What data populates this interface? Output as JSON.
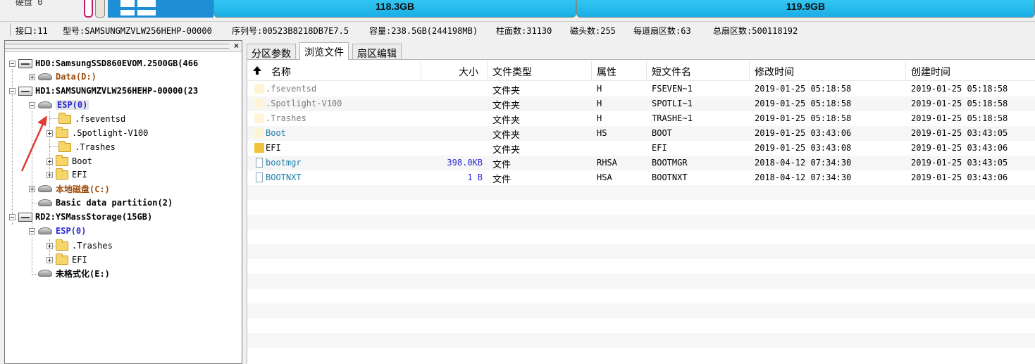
{
  "diskbar": {
    "disk_label": "硬盘 0",
    "partitions": [
      {
        "size": "118.3GB"
      },
      {
        "size": "119.9GB"
      }
    ]
  },
  "infoline": {
    "port": "接口:11",
    "model": "型号:SAMSUNGMZVLW256HEHP-00000",
    "serial": "序列号:00523B8218DB7E7.5",
    "capacity": "容量:238.5GB(244198MB)",
    "cylinders": "柱面数:31130",
    "heads": "磁头数:255",
    "sectors_per_track": "每道扇区数:63",
    "total_sectors": "总扇区数:500118192"
  },
  "tree": {
    "close": "×",
    "nodes": [
      {
        "label": "HD0:SamsungSSD860EVOM.2500GB(466"
      },
      {
        "label": "Data(D:)"
      },
      {
        "label": "HD1:SAMSUNGMZVLW256HEHP-00000(23"
      },
      {
        "label": "ESP(0)"
      },
      {
        "label": ".fseventsd"
      },
      {
        "label": ".Spotlight-V100"
      },
      {
        "label": ".Trashes"
      },
      {
        "label": "Boot"
      },
      {
        "label": "EFI"
      },
      {
        "label": "本地磁盘(C:)"
      },
      {
        "label": "Basic data partition(2)"
      },
      {
        "label": "RD2:YSMassStorage(15GB)"
      },
      {
        "label": "ESP(0)"
      },
      {
        "label": ".Trashes"
      },
      {
        "label": "EFI"
      },
      {
        "label": "未格式化(E:)"
      }
    ]
  },
  "tabs": [
    {
      "label": "分区参数"
    },
    {
      "label": "浏览文件"
    },
    {
      "label": "扇区编辑"
    }
  ],
  "table": {
    "headers": [
      "名称",
      "大小",
      "文件类型",
      "属性",
      "短文件名",
      "修改时间",
      "创建时间"
    ],
    "rows": [
      {
        "name": ".fseventsd",
        "size": "",
        "type": "文件夹",
        "attr": "H",
        "short": "FSEVEN~1",
        "modified": "2019-01-25 05:18:58",
        "created": "2019-01-25 05:18:58"
      },
      {
        "name": ".Spotlight-V100",
        "size": "",
        "type": "文件夹",
        "attr": "H",
        "short": "SPOTLI~1",
        "modified": "2019-01-25 05:18:58",
        "created": "2019-01-25 05:18:58"
      },
      {
        "name": ".Trashes",
        "size": "",
        "type": "文件夹",
        "attr": "H",
        "short": "TRASHE~1",
        "modified": "2019-01-25 05:18:58",
        "created": "2019-01-25 05:18:58"
      },
      {
        "name": "Boot",
        "size": "",
        "type": "文件夹",
        "attr": "HS",
        "short": "BOOT",
        "modified": "2019-01-25 03:43:06",
        "created": "2019-01-25 03:43:05"
      },
      {
        "name": "EFI",
        "size": "",
        "type": "文件夹",
        "attr": "",
        "short": "EFI",
        "modified": "2019-01-25 03:43:08",
        "created": "2019-01-25 03:43:06"
      },
      {
        "name": "bootmgr",
        "size": "398.0KB",
        "type": "文件",
        "attr": "RHSA",
        "short": "BOOTMGR",
        "modified": "2018-04-12 07:34:30",
        "created": "2019-01-25 03:43:05"
      },
      {
        "name": "BOOTNXT",
        "size": "1 B",
        "type": "文件",
        "attr": "HSA",
        "short": "BOOTNXT",
        "modified": "2018-04-12 07:34:30",
        "created": "2019-01-25 03:43:06"
      }
    ]
  }
}
